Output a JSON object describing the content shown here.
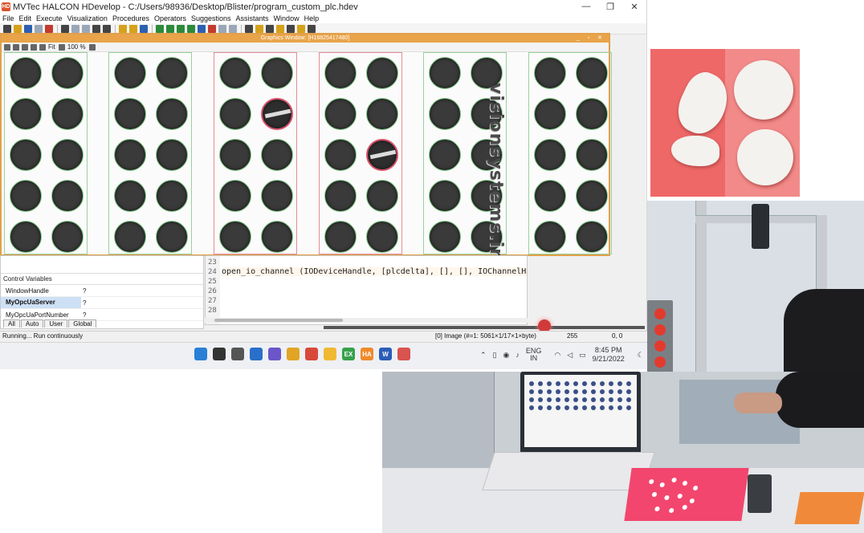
{
  "app": {
    "logo_text": "HD",
    "title": "MVTec HALCON HDevelop - C:/Users/98936/Desktop/Blister/program_custom_plc.hdev",
    "window_buttons": [
      "—",
      "❐",
      "✕"
    ],
    "menu": [
      "File",
      "Edit",
      "Execute",
      "Visualization",
      "Procedures",
      "Operators",
      "Suggestions",
      "Assistants",
      "Window",
      "Help"
    ]
  },
  "graphics_window": {
    "title": "Graphics Window: [H16825417480]",
    "title_buttons": "_ ▫ ✕",
    "fit_label": "Fit",
    "zoom_label": "100 %",
    "watermark": "visionsystems.ir",
    "strips": [
      {
        "status": "ok",
        "defect_row": -1,
        "defect_col": -1
      },
      {
        "status": "ok",
        "defect_row": -1,
        "defect_col": -1
      },
      {
        "status": "bad",
        "defect_row": 1,
        "defect_col": 1
      },
      {
        "status": "bad",
        "defect_row": 2,
        "defect_col": 1
      },
      {
        "status": "ok",
        "defect_row": -1,
        "defect_col": -1
      },
      {
        "status": "ok",
        "defect_row": -1,
        "defect_col": -1
      }
    ]
  },
  "variables": {
    "header": "Control Variables",
    "rows": [
      {
        "name": "WindowHandle",
        "value": "?"
      },
      {
        "name": "MyOpcUaServer",
        "value": "?"
      },
      {
        "name": "MyOpcUaPortNumber",
        "value": "?"
      }
    ],
    "tabs": [
      "All",
      "Auto",
      "User",
      "Global"
    ]
  },
  "code": {
    "line_numbers": [
      "23",
      "24",
      "25",
      "26",
      "27",
      "28"
    ],
    "current_line": "open_io_channel (IODeviceHandle, [plcdelta], [], [], IOChannelHandle"
  },
  "status": {
    "text": "Running... Run continuously",
    "image_info": "[0] Image (#=1: 5061×1/17×1×byte)",
    "pixel_value": "255",
    "coords": "0, 0"
  },
  "taskbar": {
    "app_labels": [
      "",
      "",
      "",
      "",
      "",
      "",
      "",
      "",
      "EX",
      "HA",
      "W",
      ""
    ],
    "lang_line1": "ENG",
    "lang_line2": "IN",
    "time": "8:45 PM",
    "date": "9/21/2022"
  }
}
